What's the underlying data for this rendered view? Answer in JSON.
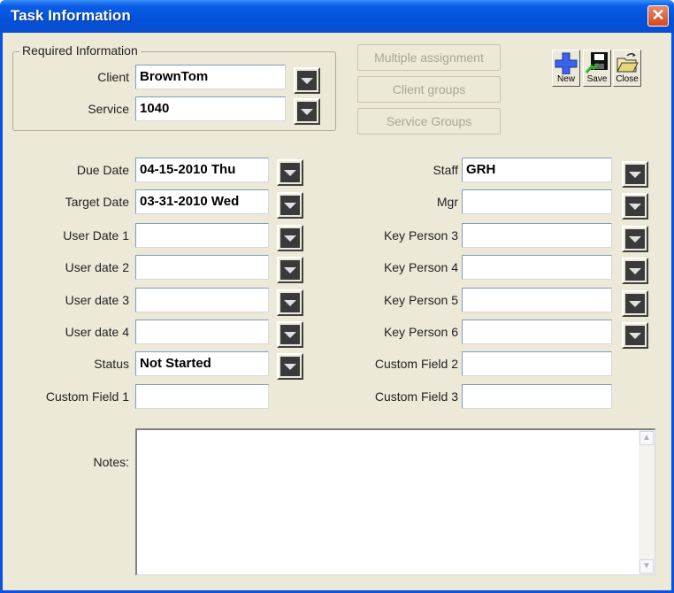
{
  "window": {
    "title": "Task Information",
    "close_glyph": "✕"
  },
  "required": {
    "legend": "Required Information",
    "client_label": "Client",
    "client_value": "BrownTom",
    "service_label": "Service",
    "service_value": "1040"
  },
  "side_buttons": {
    "multiple": "Multiple assignment",
    "client_groups": "Client groups",
    "service_groups": "Service Groups"
  },
  "toolbar": {
    "new": "New",
    "save": "Save",
    "close": "Close"
  },
  "left_fields": [
    {
      "label": "Due Date",
      "value": "04-15-2010 Thu"
    },
    {
      "label": "Target Date",
      "value": "03-31-2010 Wed"
    },
    {
      "label": "User Date 1",
      "value": ""
    },
    {
      "label": "User date 2",
      "value": ""
    },
    {
      "label": "User date 3",
      "value": ""
    },
    {
      "label": "User date 4",
      "value": ""
    },
    {
      "label": "Status",
      "value": "Not Started"
    },
    {
      "label": "Custom Field 1",
      "value": ""
    }
  ],
  "right_fields": [
    {
      "label": "Staff",
      "value": "GRH"
    },
    {
      "label": "Mgr",
      "value": ""
    },
    {
      "label": "Key Person 3",
      "value": ""
    },
    {
      "label": "Key Person 4",
      "value": ""
    },
    {
      "label": "Key Person 5",
      "value": ""
    },
    {
      "label": "Key Person 6",
      "value": ""
    },
    {
      "label": "Custom Field 2",
      "value": ""
    },
    {
      "label": "Custom Field 3",
      "value": ""
    }
  ],
  "notes": {
    "label": "Notes:",
    "value": ""
  },
  "icons": {
    "new": "plus-icon",
    "save": "floppy-disk-icon",
    "close": "open-folder-icon",
    "dropdown": "chevron-down-icon",
    "scroll_up": "scroll-up-icon",
    "scroll_down": "scroll-down-icon"
  },
  "colors": {
    "titlebar": "#0a5de8",
    "face": "#ece9d8",
    "close_button": "#d4471e"
  }
}
